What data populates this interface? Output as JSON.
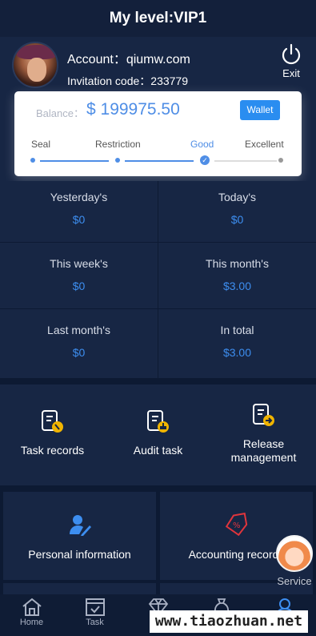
{
  "header": {
    "title": "My level:VIP1"
  },
  "profile": {
    "account_text": "Account：qiumw.com",
    "invitation_text": "Invitation code：233779",
    "exit_label": "Exit"
  },
  "balance_card": {
    "balance_label": "Balance：",
    "balance_value": "$ 199975.50",
    "wallet_label": "Wallet",
    "levels": [
      "Seal",
      "Restriction",
      "Good",
      "Excellent"
    ],
    "current_level": "Good"
  },
  "stats": [
    {
      "label": "Yesterday's",
      "value": "$0"
    },
    {
      "label": "Today's",
      "value": "$0"
    },
    {
      "label": "This week's",
      "value": "$0"
    },
    {
      "label": "This month's",
      "value": "$3.00"
    },
    {
      "label": "Last month's",
      "value": "$0"
    },
    {
      "label": "In total",
      "value": "$3.00"
    }
  ],
  "menu": [
    {
      "label": "Task records",
      "icon": "task-records-icon"
    },
    {
      "label": "Audit task",
      "icon": "audit-task-icon"
    },
    {
      "label": "Release management",
      "icon": "release-management-icon"
    }
  ],
  "menu2": [
    {
      "label": "Personal information",
      "icon": "user-edit-icon"
    },
    {
      "label": "Accounting records",
      "icon": "accounting-tag-icon"
    }
  ],
  "service": {
    "label": "Service"
  },
  "tabbar": [
    {
      "label": "Home",
      "icon": "home-icon"
    },
    {
      "label": "Task",
      "icon": "task-icon"
    },
    {
      "label": "",
      "icon": "diamond-icon"
    },
    {
      "label": "",
      "icon": "bag-icon"
    },
    {
      "label": "",
      "icon": "user-icon"
    }
  ],
  "watermark": {
    "text": "www.tiaozhuan.net"
  },
  "colors": {
    "accent": "#3d8ef0",
    "background": "#0d1a33",
    "panel": "#172644"
  }
}
